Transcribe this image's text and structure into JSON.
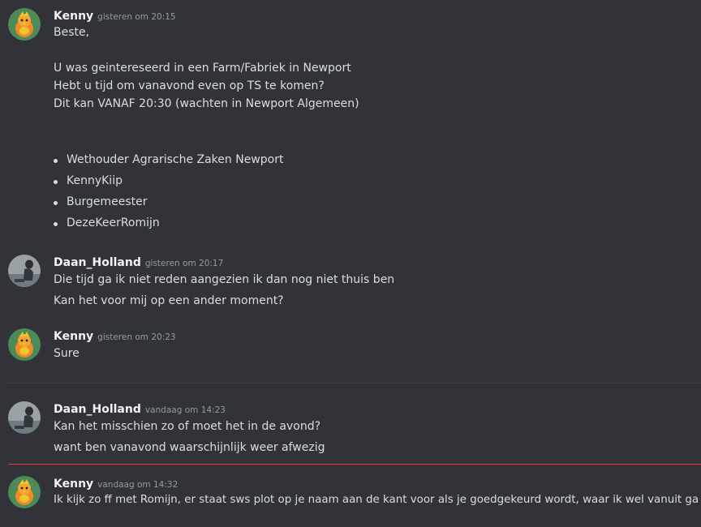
{
  "messages": [
    {
      "author": "Kenny",
      "timestamp": "gisteren om 20:15",
      "lines": [
        "Beste,",
        "U was geintereseerd in een Farm/Fabriek in Newport",
        "Hebt u tijd om vanavond even op TS te komen?",
        "Dit kan VANAF 20:30 (wachten in Newport Algemeen)"
      ],
      "bullets": [
        "Wethouder Agrarische Zaken Newport",
        "KennyKiip",
        "Burgemeester",
        "DezeKeerRomijn"
      ]
    },
    {
      "author": "Daan_Holland",
      "timestamp": "gisteren om 20:17",
      "lines": [
        "Die tijd ga ik niet reden aangezien ik dan nog niet thuis ben",
        "Kan het voor mij op een ander moment?"
      ]
    },
    {
      "author": "Kenny",
      "timestamp": "gisteren om 20:23",
      "lines": [
        "Sure"
      ]
    },
    {
      "author": "Daan_Holland",
      "timestamp": "vandaag om 14:23",
      "lines": [
        "Kan het misschien zo of moet het in de avond?",
        "want ben vanavond waarschijnlijk weer afwezig"
      ]
    },
    {
      "author": "Kenny",
      "timestamp": "vandaag om 14:32",
      "lines": [
        "Ik kijk zo ff met Romijn, er staat sws plot op je naam aan de kant voor als je goedgekeurd wordt, waar ik wel vanuit ga"
      ]
    }
  ],
  "avatars": {
    "kenny": "torchic-avatar",
    "daan": "person-photo-avatar"
  }
}
